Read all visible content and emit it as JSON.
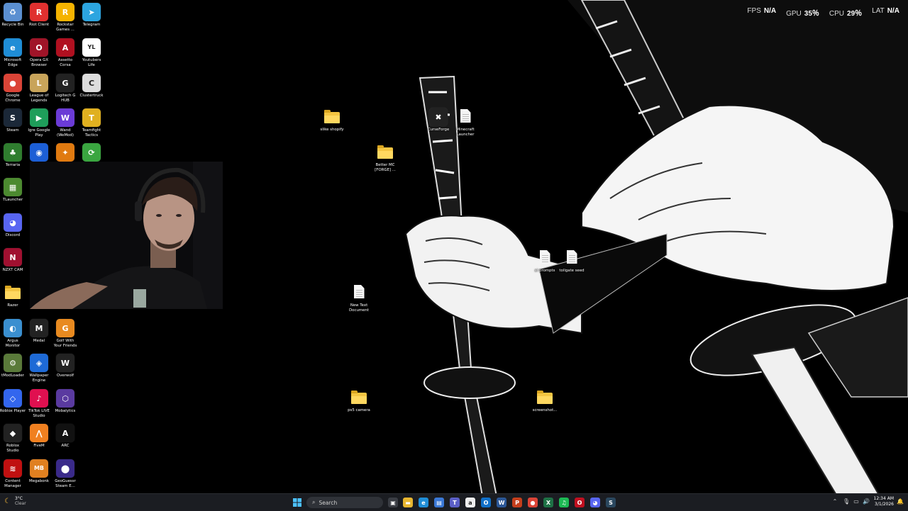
{
  "desktop": {
    "icons": [
      {
        "label": "Recycle Bin",
        "icon": "recycle-bin-icon",
        "color": "#5b8fd1",
        "glyph": "♻"
      },
      {
        "label": "Riot Client",
        "icon": "riot-client-icon",
        "color": "#e0302f",
        "glyph": "R"
      },
      {
        "label": "Rockstar\nGames ...",
        "icon": "rockstar-icon",
        "color": "#f5b300",
        "glyph": "R"
      },
      {
        "label": "Telegram",
        "icon": "telegram-icon",
        "color": "#2ca5e0",
        "glyph": "➤"
      },
      {
        "label": "Microsoft\nEdge",
        "icon": "edge-icon",
        "color": "#1f8dd6",
        "glyph": "e"
      },
      {
        "label": "Opera GX\nBrowser",
        "icon": "opera-gx-icon",
        "color": "#a01428",
        "glyph": "O"
      },
      {
        "label": "Assetto\nCorsa",
        "icon": "assetto-corsa-icon",
        "color": "#b01020",
        "glyph": "A"
      },
      {
        "label": "Youtubers\nLife",
        "icon": "youtubers-life-icon",
        "color": "#ffffff",
        "glyph": "YL"
      },
      {
        "label": "Google\nChrome",
        "icon": "chrome-icon",
        "color": "#db4437",
        "glyph": "●"
      },
      {
        "label": "League of\nLegends",
        "icon": "league-icon",
        "color": "#c8a45a",
        "glyph": "L"
      },
      {
        "label": "Logitech G\nHUB",
        "icon": "logitech-icon",
        "color": "#222222",
        "glyph": "G"
      },
      {
        "label": "Clustertruck",
        "icon": "clustertruck-icon",
        "color": "#dddddd",
        "glyph": "C"
      },
      {
        "label": "Steam",
        "icon": "steam-icon",
        "color": "#1b2838",
        "glyph": "S"
      },
      {
        "label": "Igre Google\nPlay",
        "icon": "google-play-icon",
        "color": "#1e9e5a",
        "glyph": "▶"
      },
      {
        "label": "Wand\n(WeMod)",
        "icon": "wemod-icon",
        "color": "#6b3bd6",
        "glyph": "W"
      },
      {
        "label": "Teamfight\nTactics",
        "icon": "tft-icon",
        "color": "#e0b020",
        "glyph": "T"
      },
      {
        "label": "Terraria",
        "icon": "terraria-icon",
        "color": "#2f7d2f",
        "glyph": "♣"
      },
      {
        "label": "",
        "icon": "chat-app-icon",
        "color": "#1c5fd6",
        "glyph": "◉"
      },
      {
        "label": "",
        "icon": "counter-strike-icon",
        "color": "#e07a10",
        "glyph": "✦"
      },
      {
        "label": "",
        "icon": "sync-app-icon",
        "color": "#3aa640",
        "glyph": "⟳"
      },
      {
        "label": "TLauncher",
        "icon": "tlauncher-icon",
        "color": "#4c8a30",
        "glyph": "▦"
      },
      {
        "label": "Discord",
        "icon": "discord-icon",
        "color": "#5865f2",
        "glyph": "◕"
      },
      {
        "label": "NZXT CAM",
        "icon": "nzxt-cam-icon",
        "color": "#a01030",
        "glyph": "N"
      },
      {
        "label": "Razer",
        "icon": "razer-folder-icon",
        "type": "folder"
      },
      {
        "label": "Argus\nMonitor",
        "icon": "argus-monitor-icon",
        "color": "#3a8fd0",
        "glyph": "◐"
      },
      {
        "label": "Medal",
        "icon": "medal-icon",
        "color": "#222222",
        "glyph": "M"
      },
      {
        "label": "Golf With\nYour Friends",
        "icon": "golf-icon",
        "color": "#e88a20",
        "glyph": "G"
      },
      {
        "label": "tModLoader",
        "icon": "tmodloader-icon",
        "color": "#5a7a3a",
        "glyph": "⚙"
      },
      {
        "label": "Wallpaper\nEngine",
        "icon": "wallpaper-engine-icon",
        "color": "#1e6ad6",
        "glyph": "◈"
      },
      {
        "label": "Overwolf",
        "icon": "overwolf-icon",
        "color": "#222222",
        "glyph": "W"
      },
      {
        "label": "Roblox Player",
        "icon": "roblox-player-icon",
        "color": "#3366ee",
        "glyph": "◇"
      },
      {
        "label": "TikTok LIVE\nStudio",
        "icon": "tiktok-icon",
        "color": "#e01050",
        "glyph": "♪"
      },
      {
        "label": "Mobalytics",
        "icon": "mobalytics-icon",
        "color": "#5a3aa0",
        "glyph": "⬡"
      },
      {
        "label": "Roblox\nStudio",
        "icon": "roblox-studio-icon",
        "color": "#222222",
        "glyph": "◆"
      },
      {
        "label": "FiveM",
        "icon": "fivem-icon",
        "color": "#f08020",
        "glyph": "⋀"
      },
      {
        "label": "ARC",
        "icon": "arc-icon",
        "color": "#111111",
        "glyph": "A"
      },
      {
        "label": "Content\nManager",
        "icon": "content-manager-icon",
        "color": "#c01010",
        "glyph": "≋"
      },
      {
        "label": "Megabonk",
        "icon": "megabonk-icon",
        "color": "#e08020",
        "glyph": "MB"
      },
      {
        "label": "GeoGuessr\nSteam E...",
        "icon": "geoguessr-icon",
        "color": "#3a2a8a",
        "glyph": "⬤"
      }
    ],
    "loose": [
      {
        "label": "slike shopify",
        "icon": "folder-icon",
        "type": "folder"
      },
      {
        "label": "CurseForge",
        "icon": "curseforge-icon",
        "type": "app",
        "color": "#222222",
        "glyph": "✖"
      },
      {
        "label": "Minecraft\nLauncher",
        "icon": "document-icon",
        "type": "doc"
      },
      {
        "label": "Better MC\n[FORGE] ...",
        "icon": "folder-icon",
        "type": "folder"
      },
      {
        "label": "ai prompts",
        "icon": "document-icon",
        "type": "doc"
      },
      {
        "label": "tollgate seed",
        "icon": "document-icon",
        "type": "doc"
      },
      {
        "label": "New Text\nDocument",
        "icon": "document-icon",
        "type": "doc"
      },
      {
        "label": "ps5 camera",
        "icon": "folder-icon",
        "type": "folder"
      },
      {
        "label": "screenshot...",
        "icon": "folder-icon",
        "type": "folder"
      }
    ]
  },
  "overlay": {
    "fps_label": "FPS",
    "fps_value": "N/A",
    "gpu_label": "GPU",
    "gpu_value": "35％",
    "cpu_label": "CPU",
    "cpu_value": "29％",
    "lat_label": "LAT",
    "lat_value": "N/A"
  },
  "taskbar": {
    "weather_temp": "3°C",
    "weather_desc": "Clear",
    "search_placeholder": "Search",
    "apps": [
      {
        "name": "task-view-icon",
        "color": "#3a3d44",
        "glyph": "▣"
      },
      {
        "name": "file-explorer-icon",
        "color": "#e8b630",
        "glyph": "▬"
      },
      {
        "name": "edge-taskbar-icon",
        "color": "#1f8dd6",
        "glyph": "e"
      },
      {
        "name": "store-icon",
        "color": "#3a78d6",
        "glyph": "▤"
      },
      {
        "name": "teams-icon",
        "color": "#5b5fc7",
        "glyph": "T"
      },
      {
        "name": "amazon-icon",
        "color": "#eeeeee",
        "glyph": "a"
      },
      {
        "name": "outlook-icon",
        "color": "#1070c8",
        "glyph": "O"
      },
      {
        "name": "word-icon",
        "color": "#2b5797",
        "glyph": "W"
      },
      {
        "name": "powerpoint-icon",
        "color": "#c43e1c",
        "glyph": "P"
      },
      {
        "name": "chrome-taskbar-icon",
        "color": "#db4437",
        "glyph": "●"
      },
      {
        "name": "excel-icon",
        "color": "#1e7145",
        "glyph": "X"
      },
      {
        "name": "spotify-icon",
        "color": "#1db954",
        "glyph": "♫"
      },
      {
        "name": "opera-taskbar-icon",
        "color": "#c01020",
        "glyph": "O"
      },
      {
        "name": "discord-taskbar-icon",
        "color": "#5865f2",
        "glyph": "◕"
      },
      {
        "name": "steam-taskbar-icon",
        "color": "#2a475e",
        "glyph": "S"
      }
    ],
    "time": "12:34 AM",
    "date": "3/1/2026"
  }
}
